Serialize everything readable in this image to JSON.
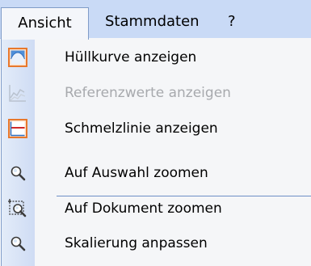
{
  "menubar": {
    "items": [
      {
        "label": "Ansicht",
        "active": true
      },
      {
        "label": "Stammdaten",
        "active": false
      },
      {
        "label": "?",
        "active": false
      }
    ]
  },
  "dropdown": {
    "groups": [
      [
        {
          "label": "Hüllkurve anzeigen",
          "icon": "envelope-curve-icon",
          "enabled": true
        },
        {
          "label": "Referenzwerte anzeigen",
          "icon": "reference-values-icon",
          "enabled": false
        },
        {
          "label": "Schmelzlinie anzeigen",
          "icon": "melt-line-icon",
          "enabled": true
        }
      ],
      [
        {
          "label": "Auf Auswahl zoomen",
          "icon": "zoom-selection-icon",
          "enabled": true
        },
        {
          "label": "Auf Dokument zoomen",
          "icon": "zoom-document-icon",
          "enabled": true
        },
        {
          "label": "Skalierung anpassen",
          "icon": "zoom-fit-icon",
          "enabled": true
        }
      ]
    ]
  },
  "colors": {
    "menubar_bg": "#c9daf6",
    "menu_border": "#7f9cc8",
    "disabled_text": "#a7a9ad",
    "icon_orange": "#e8782c"
  }
}
